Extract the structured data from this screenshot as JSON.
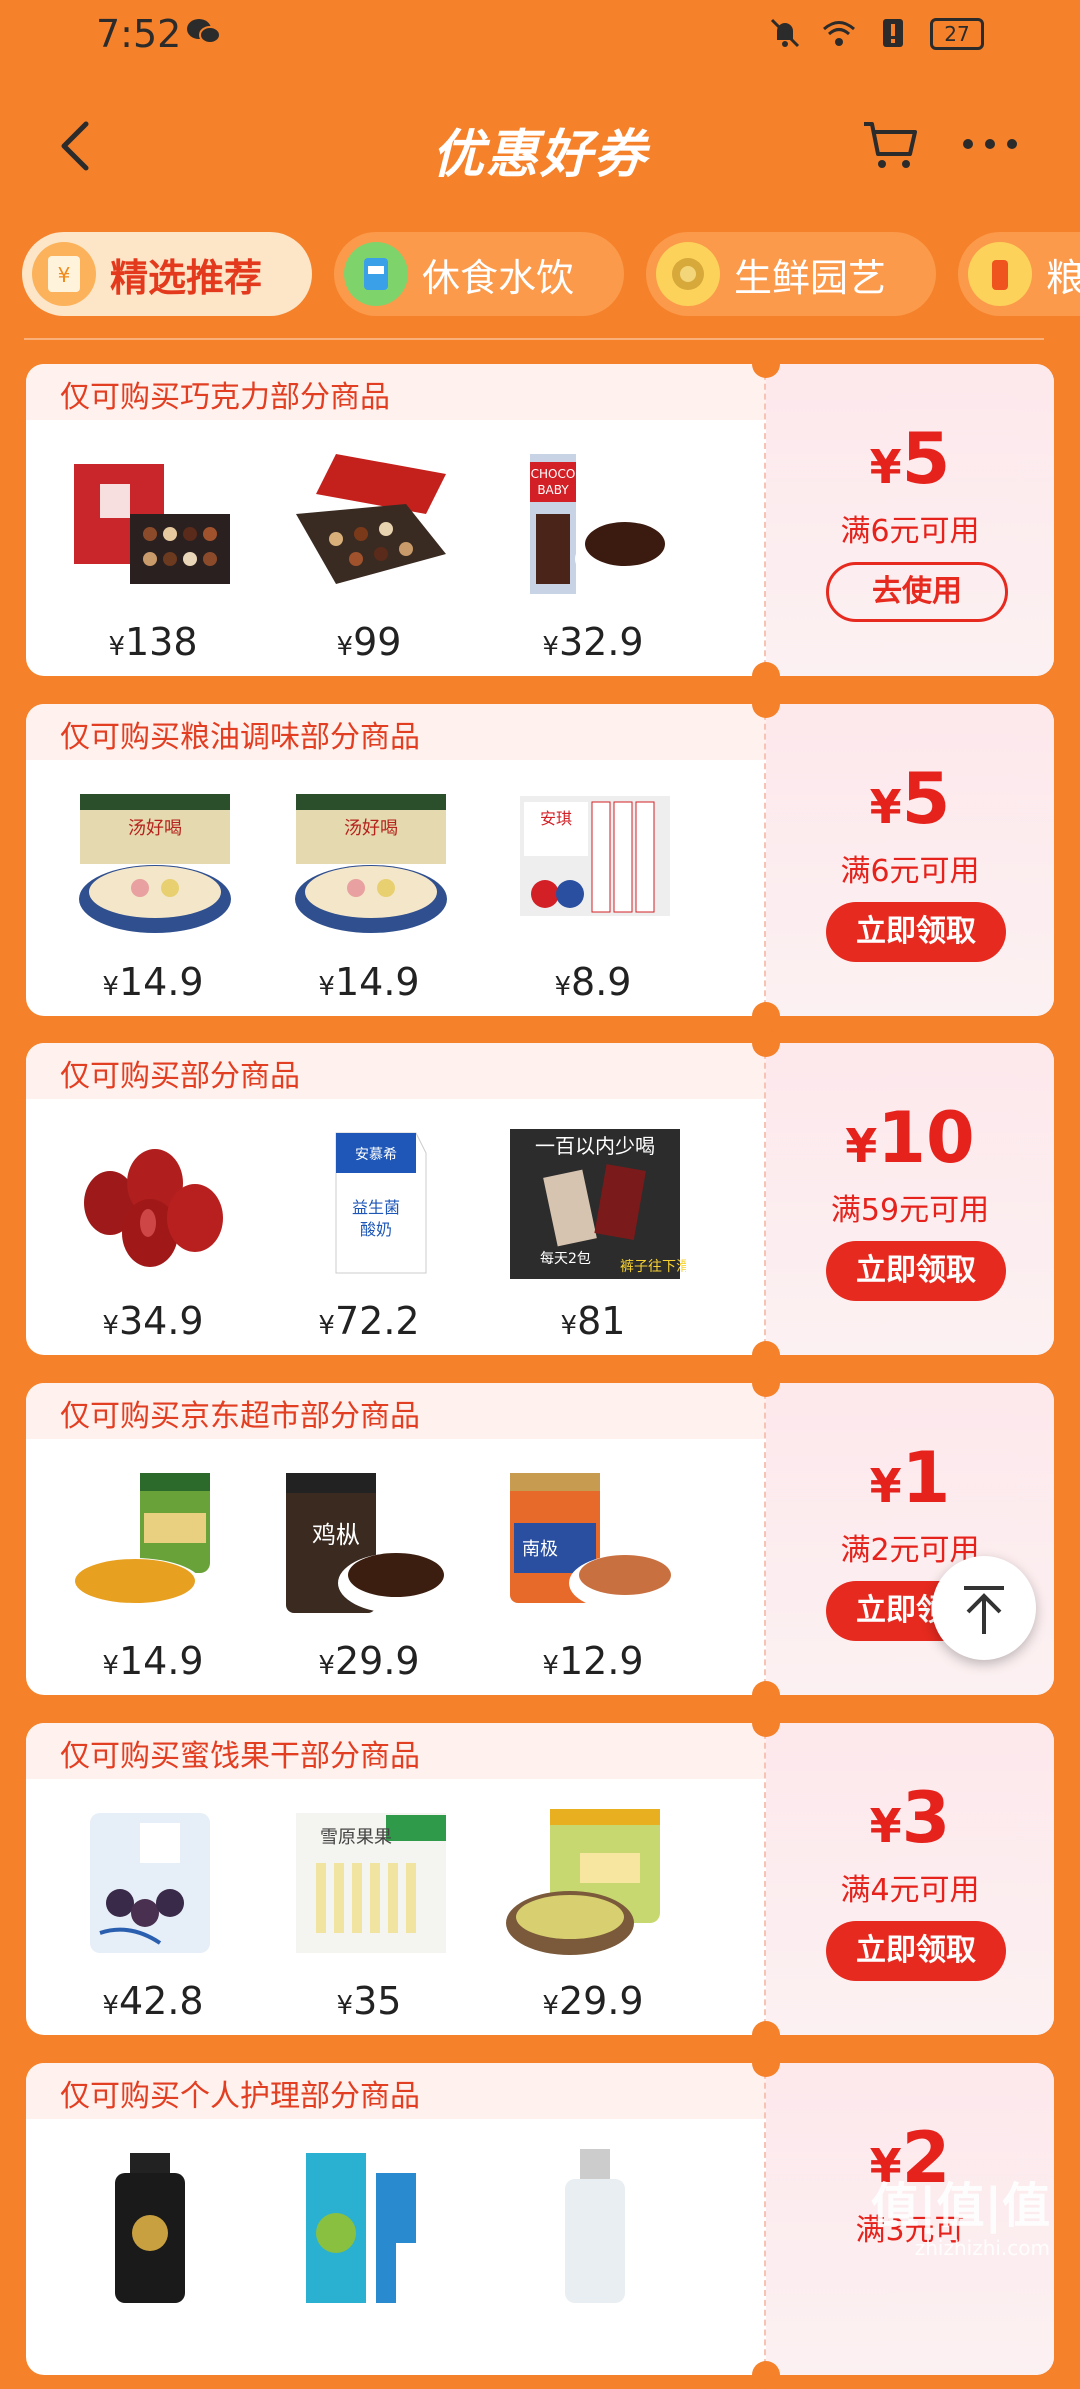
{
  "status_bar": {
    "time": "7:52",
    "battery": "27"
  },
  "header": {
    "title": "优惠好券"
  },
  "tabs": [
    {
      "label": "精选推荐"
    },
    {
      "label": "休食水饮"
    },
    {
      "label": "生鲜园艺"
    },
    {
      "label": "粮"
    }
  ],
  "coupons": [
    {
      "title": "仅可购买巧克力部分商品",
      "amount": "5",
      "condition": "满6元可用",
      "action": "去使用",
      "products": [
        {
          "price": "138",
          "icon": "chocolate-gift-box"
        },
        {
          "price": "99",
          "icon": "chocolate-box-red"
        },
        {
          "price": "32.9",
          "icon": "choco-baby-pack"
        }
      ]
    },
    {
      "title": "仅可购买粮油调味部分商品",
      "amount": "5",
      "condition": "满6元可用",
      "action": "立即领取",
      "products": [
        {
          "price": "14.9",
          "icon": "noodle-pack"
        },
        {
          "price": "14.9",
          "icon": "noodle-pack"
        },
        {
          "price": "8.9",
          "icon": "yeast-pack"
        }
      ]
    },
    {
      "title": "仅可购买部分商品",
      "amount": "10",
      "condition": "满59元可用",
      "action": "立即领取",
      "products": [
        {
          "price": "34.9",
          "icon": "red-dates"
        },
        {
          "price": "72.2",
          "icon": "yogurt-carton"
        },
        {
          "price": "81",
          "icon": "drink-sachet"
        }
      ]
    },
    {
      "title": "仅可购买京东超市部分商品",
      "amount": "1",
      "condition": "满2元可用",
      "action": "立即领取",
      "products": [
        {
          "price": "14.9",
          "icon": "pickles-jar"
        },
        {
          "price": "29.9",
          "icon": "mushroom-jar"
        },
        {
          "price": "12.9",
          "icon": "shrimp-sauce-jar"
        }
      ]
    },
    {
      "title": "仅可购买蜜饯果干部分商品",
      "amount": "3",
      "condition": "满4元可用",
      "action": "立即领取",
      "products": [
        {
          "price": "42.8",
          "icon": "dried-fruit-bag"
        },
        {
          "price": "35",
          "icon": "fruit-stick-pack"
        },
        {
          "price": "29.9",
          "icon": "raisin-jar"
        }
      ]
    },
    {
      "title": "仅可购买个人护理部分商品",
      "amount": "2",
      "condition": "满3元可",
      "action": "",
      "products": [
        {
          "price": "",
          "icon": "shampoo-bottle"
        },
        {
          "price": "",
          "icon": "toothpaste"
        },
        {
          "price": "",
          "icon": "lotion-bottle"
        }
      ]
    }
  ],
  "watermark": {
    "main": "值|值|值",
    "sub": "zhizhizhi.com"
  },
  "colors": {
    "background": "#f5812a",
    "accent": "#e5231c",
    "button": "#e62a1f"
  }
}
